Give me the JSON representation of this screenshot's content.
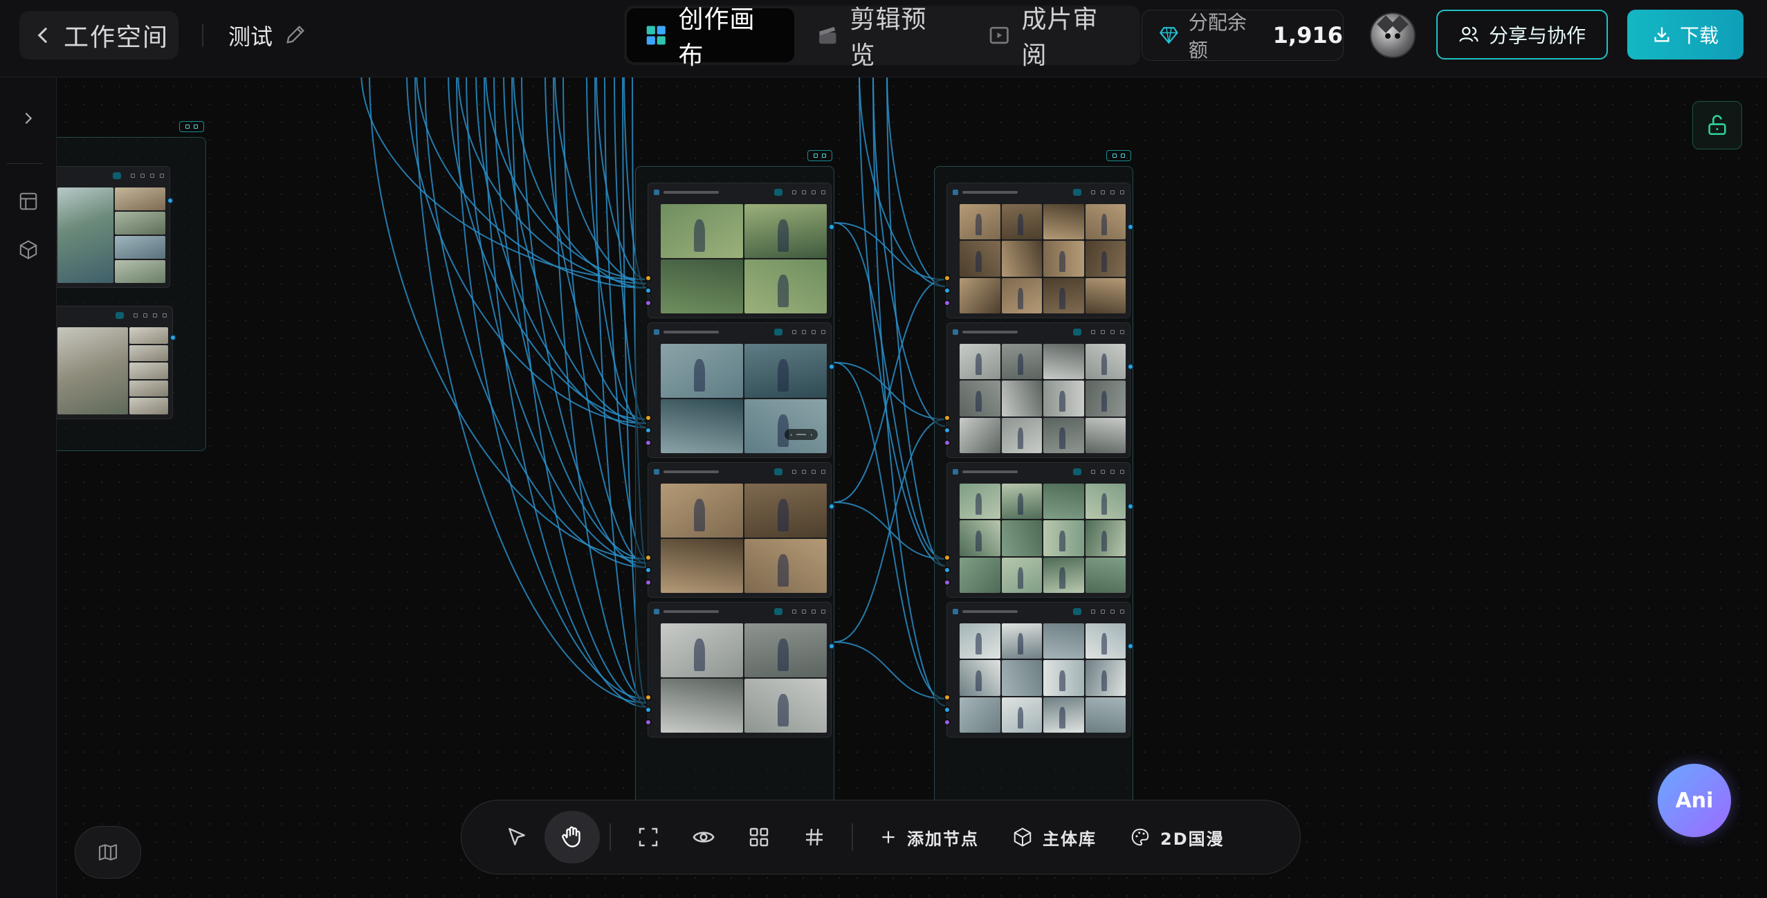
{
  "header": {
    "back_label": "工作空间",
    "project_name": "测试",
    "modes": [
      {
        "label": "创作画布",
        "active": true,
        "icon": "grid-color-icon"
      },
      {
        "label": "剪辑预览",
        "active": false,
        "icon": "clapper-icon"
      },
      {
        "label": "成片审阅",
        "active": false,
        "icon": "film-icon"
      }
    ],
    "balance_label": "分配余额",
    "balance_value": "1,916",
    "share_label": "分享与协作",
    "download_label": "下载"
  },
  "toolbar": {
    "add_node_label": "添加节点",
    "subject_library_label": "主体库",
    "style_label": "2D国漫"
  },
  "assistant": {
    "label": "Ani"
  },
  "colors": {
    "accent": "#1fc2c6",
    "wire": "#2a8fc9",
    "port_orange": "#e5a21a",
    "port_blue": "#29a5e6",
    "port_purple": "#9b5de5",
    "assistant_gradient_start": "#6aa8ff",
    "assistant_gradient_end": "#9b6bff"
  }
}
